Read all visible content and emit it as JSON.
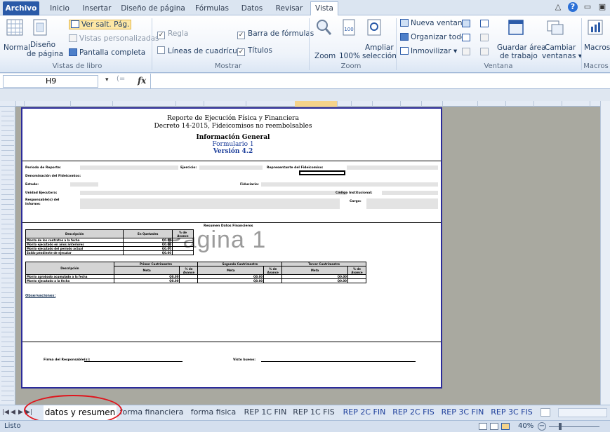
{
  "ribbon": {
    "tabs": [
      "Archivo",
      "Inicio",
      "Insertar",
      "Diseño de página",
      "Fórmulas",
      "Datos",
      "Revisar",
      "Vista"
    ],
    "active_tab": "Vista",
    "workbook_views": {
      "normal": "Normal",
      "page_layout_1": "Diseño",
      "page_layout_2": "de página",
      "page_break": "Ver salt. Pág.",
      "custom_views": "Vistas personalizadas",
      "full_screen": "Pantalla completa",
      "group": "Vistas de libro"
    },
    "show": {
      "ruler": "Regla",
      "formula_bar": "Barra de fórmulas",
      "gridlines": "Líneas de cuadrícula",
      "headings": "Títulos",
      "group": "Mostrar"
    },
    "zoom": {
      "zoom": "Zoom",
      "hundred": "100%",
      "zoom_selection_1": "Ampliar",
      "zoom_selection_2": "selección",
      "group": "Zoom"
    },
    "window": {
      "new_window": "Nueva ventana",
      "arrange_all": "Organizar todo",
      "freeze": "Inmovilizar",
      "save_workspace_1": "Guardar área",
      "save_workspace_2": "de trabajo",
      "switch_windows_1": "Cambiar",
      "switch_windows_2": "ventanas",
      "group": "Ventana"
    },
    "macros": {
      "label": "Macros",
      "group": "Macros"
    }
  },
  "formula_bar": {
    "name_box": "H9",
    "fx": "fx",
    "content": ""
  },
  "report": {
    "title1": "Reporte de Ejecución Física y Financiera",
    "title2": "Decreto 14-2015, Fideicomisos no reembolsables",
    "title3": "Información General",
    "title4": "Formulario 1",
    "title5": "Versión 4.2",
    "f_period": "Período de Reporte:",
    "f_year": "Ejercicio:",
    "f_rep": "Representante del Fideicomiso:",
    "f_name": "Denominación del Fideicomiso:",
    "f_state": "Estado:",
    "f_fid": "Fiduciario:",
    "f_unit": "Unidad Ejecutora:",
    "f_code": "Código Institucional:",
    "f_resp1": "Responsable(s) del",
    "f_resp2": "Informe:",
    "f_cargo": "Cargo:",
    "sum_title": "Resumen Datos Financieros",
    "t1_desc": "Descripción",
    "t1_q": "En Quetzales",
    "t1_pct": "% de Avance",
    "t1_rows": [
      "Monto de los contratos a la fecha",
      "Monto ejecutado en años anteriores",
      "Monto ejecutado del período actual",
      "Saldo pendiente de ejecutar"
    ],
    "t1_val": "Q0.00",
    "t2_desc": "Descripción",
    "t2_q1": "Primer Cuatrimestre",
    "t2_q2": "Segundo Cuatrimestre",
    "t2_q3": "Tercer Cuatrimestre",
    "t2_meta": "Meta",
    "t2_pct": "% de Avance",
    "t2_rows": [
      "Monto aprobado acumulado a la fecha",
      "Monto ejecutado a la fecha"
    ],
    "obs": "Observaciones:",
    "sign1": "Firma del Responsable(s):",
    "sign2": "Visto bueno:",
    "watermark": "Página 1"
  },
  "sheet_tabs": [
    "datos y resumen",
    "forma financiera",
    "forma fisica",
    "REP 1C FIN",
    "REP 1C FIS",
    "REP 2C FIN",
    "REP 2C FIS",
    "REP 3C FIN",
    "REP 3C FIS"
  ],
  "status": {
    "ready": "Listo",
    "zoom": "40%"
  },
  "colors": {
    "file_tab": "#2a5aa8",
    "page_border": "#2b2b9a",
    "highlight_circle": "#e0141c"
  }
}
